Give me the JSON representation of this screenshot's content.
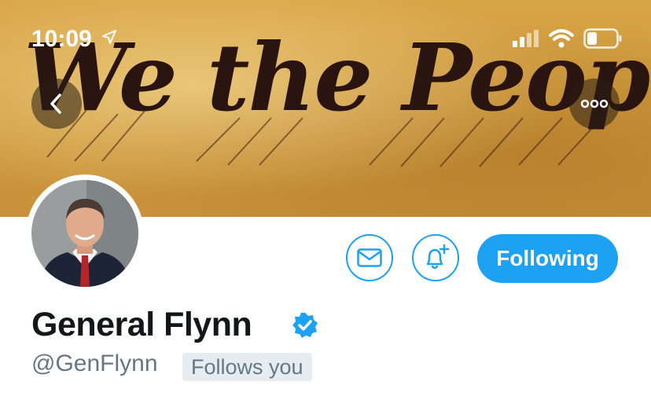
{
  "status_bar": {
    "time": "10:09",
    "icons": [
      "location-arrow-icon",
      "signal-icon",
      "wifi-icon",
      "battery-icon"
    ]
  },
  "banner": {
    "text": "We the People",
    "colors": {
      "paper": "#d9a445",
      "ink": "#2a1410"
    }
  },
  "nav": {
    "back_icon": "chevron-left-icon",
    "more_icon": "ellipsis-icon"
  },
  "profile": {
    "display_name": "General Flynn",
    "verified": true,
    "handle": "@GenFlynn",
    "follows_you_label": "Follows you"
  },
  "actions": {
    "message_icon": "envelope-icon",
    "notify_icon": "bell-plus-icon",
    "follow_label": "Following"
  },
  "colors": {
    "accent": "#1da1f2",
    "text": "#14171a",
    "secondary": "#657786",
    "badge_bg": "#e6ecf0"
  }
}
